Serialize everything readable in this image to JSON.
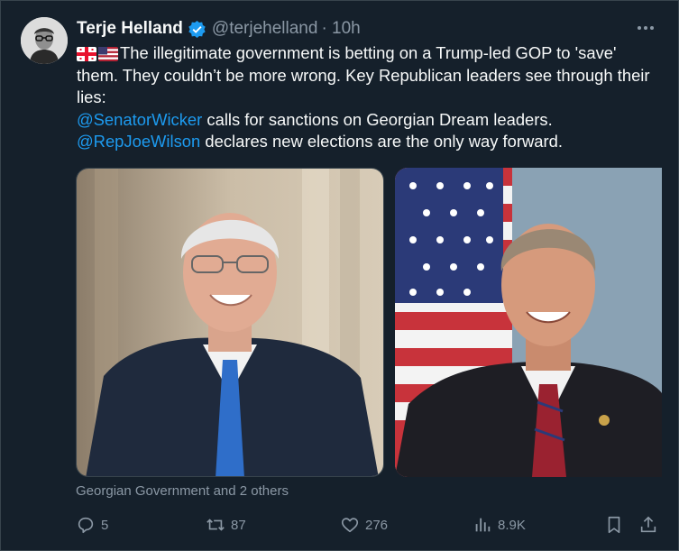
{
  "author": {
    "name": "Terje Helland",
    "handle": "@terjehelland",
    "time": "· 10h"
  },
  "tweet": {
    "line1": "The illegitimate government is betting on a Trump-led GOP to 'save' them. They couldn’t be more wrong. Key Republican leaders see through their lies:",
    "mention1": "@SenatorWicker",
    "line2_rest": " calls for sanctions on Georgian Dream leaders.",
    "mention2": "@RepJoeWilson",
    "line3_rest": " declares new elections are the only way forward."
  },
  "media_tagline": "Georgian Government and 2 others",
  "actions": {
    "replies": "5",
    "reposts": "87",
    "likes": "276",
    "views": "8.9K"
  },
  "icons": {
    "verified": "verified-badge-icon",
    "more": "more-icon",
    "reply": "reply-icon",
    "repost": "repost-icon",
    "like": "like-icon",
    "views": "views-icon",
    "bookmark": "bookmark-icon",
    "share": "share-icon"
  },
  "colors": {
    "background": "#15202b",
    "link": "#1d9bf0",
    "muted": "#8b98a5"
  }
}
